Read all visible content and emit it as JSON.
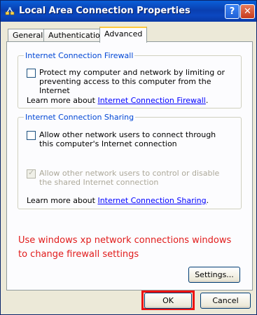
{
  "window": {
    "title": "Local Area Connection Properties",
    "help_glyph": "?",
    "close_glyph": "✕"
  },
  "tabs": [
    {
      "label": "General"
    },
    {
      "label": "Authentication"
    },
    {
      "label": "Advanced",
      "selected": true
    }
  ],
  "firewall": {
    "group_title": "Internet Connection Firewall",
    "checkbox_label": "Protect my computer and network by limiting or preventing access to this computer from the Internet",
    "checked": false,
    "learn_prefix": "Learn more about ",
    "learn_link": "Internet Connection Firewall",
    "learn_suffix": "."
  },
  "sharing": {
    "group_title": "Internet Connection Sharing",
    "allow_connect_label": "Allow other network users to connect through this computer's Internet connection",
    "allow_connect_checked": false,
    "allow_control_label": "Allow other network users to control or disable the shared Internet connection",
    "allow_control_checked": true,
    "allow_control_enabled": false,
    "learn_prefix": "Learn more about ",
    "learn_link": "Internet Connection Sharing",
    "learn_suffix": "."
  },
  "annotation": {
    "text": "Use windows xp network connections windows to change firewall settings",
    "color": "#e11b1b",
    "highlight_color": "#ee1111"
  },
  "buttons": {
    "settings": "Settings...",
    "ok": "OK",
    "cancel": "Cancel"
  }
}
